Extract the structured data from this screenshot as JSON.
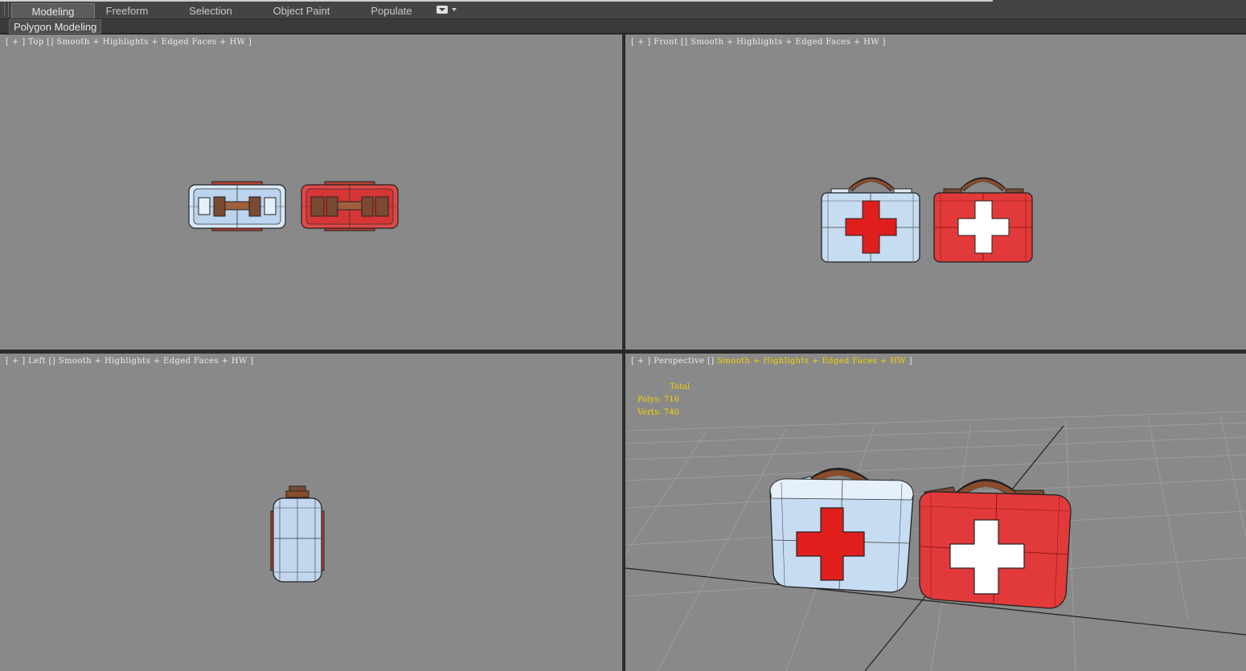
{
  "ribbon": {
    "tabs": [
      {
        "label": "Modeling",
        "active": true
      },
      {
        "label": "Freeform",
        "active": false
      },
      {
        "label": "Selection",
        "active": false
      },
      {
        "label": "Object Paint",
        "active": false
      },
      {
        "label": "Populate",
        "active": false
      }
    ],
    "panel_label": "Polygon Modeling"
  },
  "viewports": {
    "top": {
      "bracket_open": "[ + ]",
      "name": "Top",
      "shading": "Smooth + Highlights + Edged Faces + HW ]"
    },
    "front": {
      "bracket_open": "[ + ]",
      "name": "Front",
      "shading": "Smooth + Highlights + Edged Faces + HW ]"
    },
    "left": {
      "bracket_open": "[ + ]",
      "name": "Left",
      "shading": "Smooth + Highlights + Edged Faces + HW ]"
    },
    "perspective": {
      "bracket_open": "[ + ]",
      "name": "Perspective",
      "shading": "Smooth + Highlights + Edged Faces + HW",
      "bracket_close": "]",
      "stats": {
        "total_label": "Total",
        "polys_label": "Polys:",
        "polys": "716",
        "verts_label": "Verts:",
        "verts": "740"
      }
    }
  },
  "colors": {
    "viewport_bg": "#898989",
    "stats_highlight": "#f5d200",
    "kit_blue": "#c6dcf2",
    "kit_red": "#e23a3a",
    "cross_red": "#e01e1e",
    "handle_brown": "#8a4d2c"
  },
  "icons": [
    "ribbon-options-icon"
  ]
}
